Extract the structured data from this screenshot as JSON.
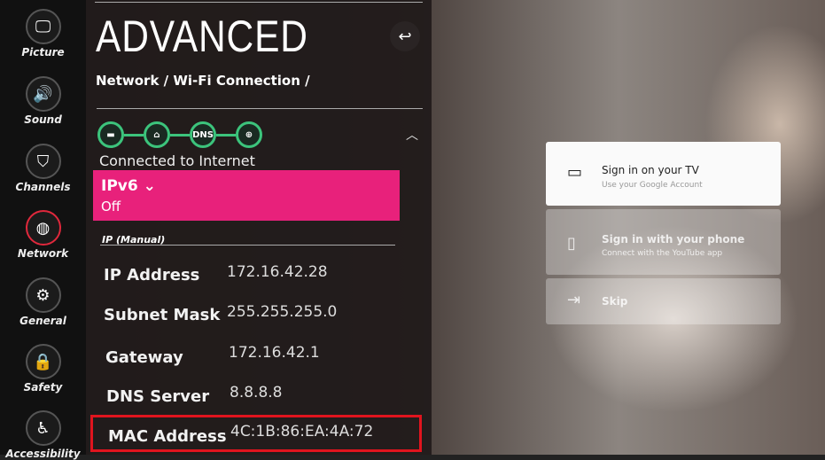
{
  "sidebar": {
    "items": [
      {
        "label": "Picture",
        "icon": "picture-icon"
      },
      {
        "label": "Sound",
        "icon": "speaker-icon"
      },
      {
        "label": "Channels",
        "icon": "satellite-dish-icon"
      },
      {
        "label": "Network",
        "icon": "globe-icon",
        "active": true
      },
      {
        "label": "General",
        "icon": "gear-icon"
      },
      {
        "label": "Safety",
        "icon": "lock-icon"
      },
      {
        "label": "Accessibility",
        "icon": "accessibility-icon"
      }
    ]
  },
  "panel": {
    "title": "ADVANCED",
    "breadcrumb": "Network / Wi-Fi Connection /",
    "connection_steps": [
      "tv",
      "router",
      "DNS",
      "internet"
    ],
    "status": "Connected to Internet",
    "ipv6": {
      "label": "IPv6",
      "value": "Off"
    },
    "section": "IP (Manual)",
    "rows": [
      {
        "label": "IP Address",
        "value": "172.16.42.28"
      },
      {
        "label": "Subnet Mask",
        "value": "255.255.255.0"
      },
      {
        "label": "Gateway",
        "value": "172.16.42.1"
      },
      {
        "label": "DNS Server",
        "value": "8.8.8.8"
      },
      {
        "label": "MAC Address",
        "value": "4C:1B:86:EA:4A:72"
      }
    ]
  },
  "background": {
    "cards": [
      {
        "title": "Sign in on your TV",
        "subtitle": "Use your Google Account"
      },
      {
        "title": "Sign in with your phone",
        "subtitle": "Connect with the YouTube app"
      },
      {
        "title": "Skip",
        "subtitle": ""
      }
    ]
  },
  "colors": {
    "accent": "#e8217b",
    "connected": "#3cc47c",
    "highlight": "#e0141e"
  }
}
